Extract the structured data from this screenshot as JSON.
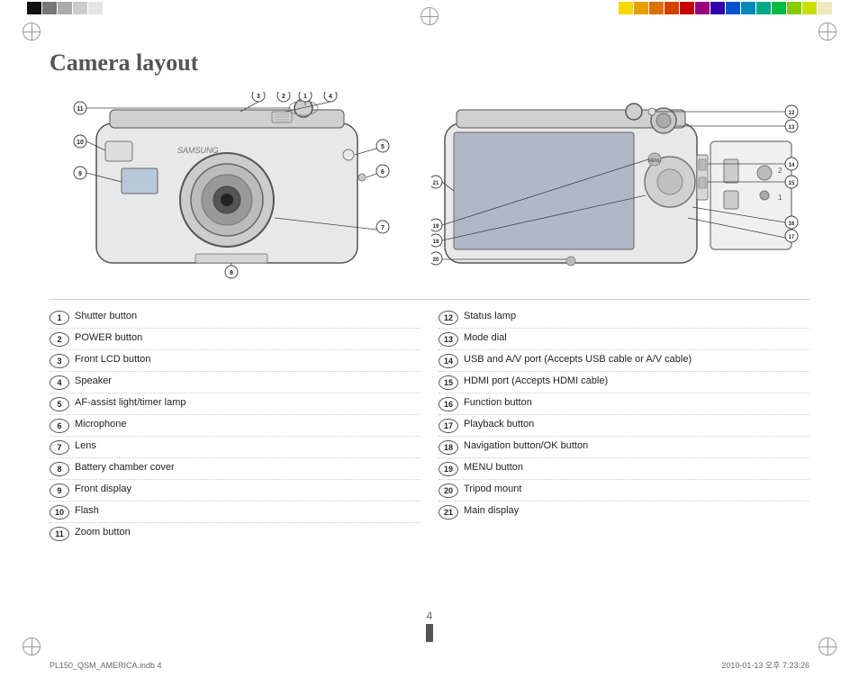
{
  "page": {
    "title": "Camera layout",
    "page_number": "4",
    "footer_left": "PL150_QSM_AMERICA.indb   4",
    "footer_right": "2010-01-13   오후 7:23:26"
  },
  "color_bar": {
    "left_swatches": [
      "#1a1a1a",
      "#888",
      "#aaa",
      "#ccc",
      "#ddd"
    ],
    "right_swatches": [
      "#f5d800",
      "#e8a000",
      "#e07000",
      "#d44000",
      "#c80000",
      "#9b0080",
      "#3300aa",
      "#0055cc",
      "#0088bb",
      "#00aa88",
      "#00bb44",
      "#88cc00",
      "#ccdd00",
      "#eee8c0"
    ]
  },
  "legend_left": [
    {
      "number": "1",
      "text": "Shutter button"
    },
    {
      "number": "2",
      "text": "POWER button"
    },
    {
      "number": "3",
      "text": "Front LCD button"
    },
    {
      "number": "4",
      "text": "Speaker"
    },
    {
      "number": "5",
      "text": "AF-assist light/timer lamp"
    },
    {
      "number": "6",
      "text": "Microphone"
    },
    {
      "number": "7",
      "text": "Lens"
    },
    {
      "number": "8",
      "text": "Battery chamber cover"
    },
    {
      "number": "9",
      "text": "Front display"
    },
    {
      "number": "10",
      "text": "Flash"
    },
    {
      "number": "11",
      "text": "Zoom button"
    }
  ],
  "legend_right": [
    {
      "number": "12",
      "text": "Status lamp"
    },
    {
      "number": "13",
      "text": "Mode dial"
    },
    {
      "number": "14",
      "text": "USB and A/V port (Accepts USB cable or A/V cable)"
    },
    {
      "number": "15",
      "text": "HDMI port (Accepts HDMI cable)"
    },
    {
      "number": "16",
      "text": "Function button"
    },
    {
      "number": "17",
      "text": "Playback button"
    },
    {
      "number": "18",
      "text": "Navigation button/OK button"
    },
    {
      "number": "19",
      "text": "MENU button"
    },
    {
      "number": "20",
      "text": "Tripod mount"
    },
    {
      "number": "21",
      "text": "Main display"
    }
  ]
}
